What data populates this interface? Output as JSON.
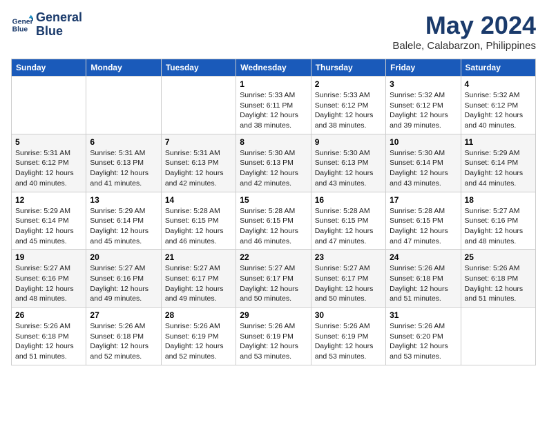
{
  "logo": {
    "line1": "General",
    "line2": "Blue"
  },
  "title": "May 2024",
  "location": "Balele, Calabarzon, Philippines",
  "days_header": [
    "Sunday",
    "Monday",
    "Tuesday",
    "Wednesday",
    "Thursday",
    "Friday",
    "Saturday"
  ],
  "weeks": [
    [
      {
        "day": "",
        "sunrise": "",
        "sunset": "",
        "daylight": ""
      },
      {
        "day": "",
        "sunrise": "",
        "sunset": "",
        "daylight": ""
      },
      {
        "day": "",
        "sunrise": "",
        "sunset": "",
        "daylight": ""
      },
      {
        "day": "1",
        "sunrise": "Sunrise: 5:33 AM",
        "sunset": "Sunset: 6:11 PM",
        "daylight": "Daylight: 12 hours and 38 minutes."
      },
      {
        "day": "2",
        "sunrise": "Sunrise: 5:33 AM",
        "sunset": "Sunset: 6:12 PM",
        "daylight": "Daylight: 12 hours and 38 minutes."
      },
      {
        "day": "3",
        "sunrise": "Sunrise: 5:32 AM",
        "sunset": "Sunset: 6:12 PM",
        "daylight": "Daylight: 12 hours and 39 minutes."
      },
      {
        "day": "4",
        "sunrise": "Sunrise: 5:32 AM",
        "sunset": "Sunset: 6:12 PM",
        "daylight": "Daylight: 12 hours and 40 minutes."
      }
    ],
    [
      {
        "day": "5",
        "sunrise": "Sunrise: 5:31 AM",
        "sunset": "Sunset: 6:12 PM",
        "daylight": "Daylight: 12 hours and 40 minutes."
      },
      {
        "day": "6",
        "sunrise": "Sunrise: 5:31 AM",
        "sunset": "Sunset: 6:13 PM",
        "daylight": "Daylight: 12 hours and 41 minutes."
      },
      {
        "day": "7",
        "sunrise": "Sunrise: 5:31 AM",
        "sunset": "Sunset: 6:13 PM",
        "daylight": "Daylight: 12 hours and 42 minutes."
      },
      {
        "day": "8",
        "sunrise": "Sunrise: 5:30 AM",
        "sunset": "Sunset: 6:13 PM",
        "daylight": "Daylight: 12 hours and 42 minutes."
      },
      {
        "day": "9",
        "sunrise": "Sunrise: 5:30 AM",
        "sunset": "Sunset: 6:13 PM",
        "daylight": "Daylight: 12 hours and 43 minutes."
      },
      {
        "day": "10",
        "sunrise": "Sunrise: 5:30 AM",
        "sunset": "Sunset: 6:14 PM",
        "daylight": "Daylight: 12 hours and 43 minutes."
      },
      {
        "day": "11",
        "sunrise": "Sunrise: 5:29 AM",
        "sunset": "Sunset: 6:14 PM",
        "daylight": "Daylight: 12 hours and 44 minutes."
      }
    ],
    [
      {
        "day": "12",
        "sunrise": "Sunrise: 5:29 AM",
        "sunset": "Sunset: 6:14 PM",
        "daylight": "Daylight: 12 hours and 45 minutes."
      },
      {
        "day": "13",
        "sunrise": "Sunrise: 5:29 AM",
        "sunset": "Sunset: 6:14 PM",
        "daylight": "Daylight: 12 hours and 45 minutes."
      },
      {
        "day": "14",
        "sunrise": "Sunrise: 5:28 AM",
        "sunset": "Sunset: 6:15 PM",
        "daylight": "Daylight: 12 hours and 46 minutes."
      },
      {
        "day": "15",
        "sunrise": "Sunrise: 5:28 AM",
        "sunset": "Sunset: 6:15 PM",
        "daylight": "Daylight: 12 hours and 46 minutes."
      },
      {
        "day": "16",
        "sunrise": "Sunrise: 5:28 AM",
        "sunset": "Sunset: 6:15 PM",
        "daylight": "Daylight: 12 hours and 47 minutes."
      },
      {
        "day": "17",
        "sunrise": "Sunrise: 5:28 AM",
        "sunset": "Sunset: 6:15 PM",
        "daylight": "Daylight: 12 hours and 47 minutes."
      },
      {
        "day": "18",
        "sunrise": "Sunrise: 5:27 AM",
        "sunset": "Sunset: 6:16 PM",
        "daylight": "Daylight: 12 hours and 48 minutes."
      }
    ],
    [
      {
        "day": "19",
        "sunrise": "Sunrise: 5:27 AM",
        "sunset": "Sunset: 6:16 PM",
        "daylight": "Daylight: 12 hours and 48 minutes."
      },
      {
        "day": "20",
        "sunrise": "Sunrise: 5:27 AM",
        "sunset": "Sunset: 6:16 PM",
        "daylight": "Daylight: 12 hours and 49 minutes."
      },
      {
        "day": "21",
        "sunrise": "Sunrise: 5:27 AM",
        "sunset": "Sunset: 6:17 PM",
        "daylight": "Daylight: 12 hours and 49 minutes."
      },
      {
        "day": "22",
        "sunrise": "Sunrise: 5:27 AM",
        "sunset": "Sunset: 6:17 PM",
        "daylight": "Daylight: 12 hours and 50 minutes."
      },
      {
        "day": "23",
        "sunrise": "Sunrise: 5:27 AM",
        "sunset": "Sunset: 6:17 PM",
        "daylight": "Daylight: 12 hours and 50 minutes."
      },
      {
        "day": "24",
        "sunrise": "Sunrise: 5:26 AM",
        "sunset": "Sunset: 6:18 PM",
        "daylight": "Daylight: 12 hours and 51 minutes."
      },
      {
        "day": "25",
        "sunrise": "Sunrise: 5:26 AM",
        "sunset": "Sunset: 6:18 PM",
        "daylight": "Daylight: 12 hours and 51 minutes."
      }
    ],
    [
      {
        "day": "26",
        "sunrise": "Sunrise: 5:26 AM",
        "sunset": "Sunset: 6:18 PM",
        "daylight": "Daylight: 12 hours and 51 minutes."
      },
      {
        "day": "27",
        "sunrise": "Sunrise: 5:26 AM",
        "sunset": "Sunset: 6:18 PM",
        "daylight": "Daylight: 12 hours and 52 minutes."
      },
      {
        "day": "28",
        "sunrise": "Sunrise: 5:26 AM",
        "sunset": "Sunset: 6:19 PM",
        "daylight": "Daylight: 12 hours and 52 minutes."
      },
      {
        "day": "29",
        "sunrise": "Sunrise: 5:26 AM",
        "sunset": "Sunset: 6:19 PM",
        "daylight": "Daylight: 12 hours and 53 minutes."
      },
      {
        "day": "30",
        "sunrise": "Sunrise: 5:26 AM",
        "sunset": "Sunset: 6:19 PM",
        "daylight": "Daylight: 12 hours and 53 minutes."
      },
      {
        "day": "31",
        "sunrise": "Sunrise: 5:26 AM",
        "sunset": "Sunset: 6:20 PM",
        "daylight": "Daylight: 12 hours and 53 minutes."
      },
      {
        "day": "",
        "sunrise": "",
        "sunset": "",
        "daylight": ""
      }
    ]
  ]
}
